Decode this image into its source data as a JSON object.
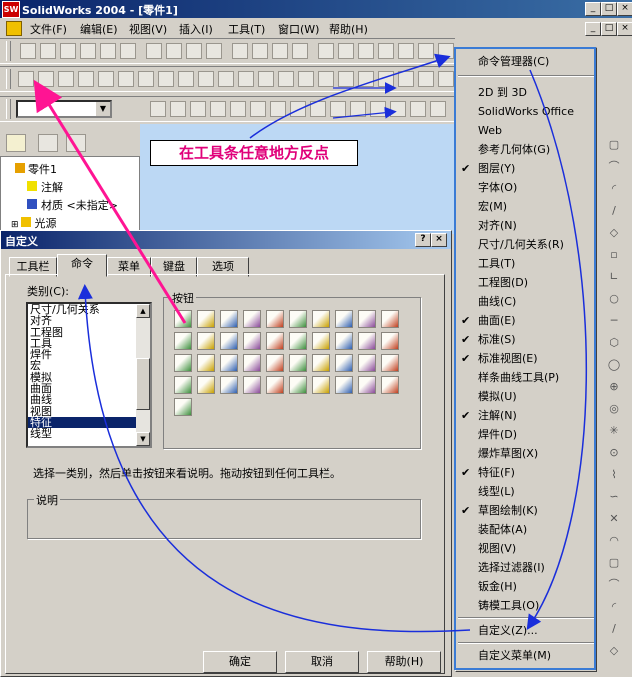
{
  "app": {
    "title": "SolidWorks 2004 - [零件1]",
    "logo_text": "SW"
  },
  "window_buttons": {
    "minimize": "_",
    "maximize": "□",
    "close": "×"
  },
  "menubar": {
    "items": [
      "文件(F)",
      "编辑(E)",
      "视图(V)",
      "插入(I)",
      "工具(T)",
      "窗口(W)",
      "帮助(H)"
    ]
  },
  "tree": {
    "items": [
      "零件1",
      "注解",
      "材质 <未指定>",
      "光源"
    ]
  },
  "callout": {
    "text": "在工具条任意地方反点"
  },
  "dialog": {
    "title": "自定义",
    "tabs": [
      "工具栏",
      "命令",
      "菜单",
      "键盘",
      "选项"
    ],
    "category_label": "类别(C):",
    "categories": [
      "尺寸/几何关系",
      "对齐",
      "工程图",
      "工具",
      "焊件",
      "宏",
      "模拟",
      "曲面",
      "曲线",
      "视图",
      "特征",
      "线型"
    ],
    "selected_category": "特征",
    "buttons_label": "按钮",
    "hint": "选择一类别，然后单击按钮来看说明。拖动按钮到任何工具栏。",
    "description_label": "说明",
    "ok": "确定",
    "cancel": "取消",
    "help": "帮助(H)"
  },
  "context_menu": {
    "items": [
      {
        "label": "命令管理器(C)",
        "checked": false
      },
      {
        "label": "2D 到 3D",
        "checked": false
      },
      {
        "label": "SolidWorks Office",
        "checked": false
      },
      {
        "label": "Web",
        "checked": false
      },
      {
        "label": "参考几何体(G)",
        "checked": false
      },
      {
        "label": "图层(Y)",
        "checked": true
      },
      {
        "label": "字体(O)",
        "checked": false
      },
      {
        "label": "宏(M)",
        "checked": false
      },
      {
        "label": "对齐(N)",
        "checked": false
      },
      {
        "label": "尺寸/几何关系(R)",
        "checked": false
      },
      {
        "label": "工具(T)",
        "checked": false
      },
      {
        "label": "工程图(D)",
        "checked": false
      },
      {
        "label": "曲线(C)",
        "checked": false
      },
      {
        "label": "曲面(E)",
        "checked": true
      },
      {
        "label": "标准(S)",
        "checked": true
      },
      {
        "label": "标准视图(E)",
        "checked": true
      },
      {
        "label": "样条曲线工具(P)",
        "checked": false
      },
      {
        "label": "模拟(U)",
        "checked": false
      },
      {
        "label": "注解(N)",
        "checked": true
      },
      {
        "label": "焊件(D)",
        "checked": false
      },
      {
        "label": "爆炸草图(X)",
        "checked": false
      },
      {
        "label": "特征(F)",
        "checked": true
      },
      {
        "label": "线型(L)",
        "checked": false
      },
      {
        "label": "草图绘制(K)",
        "checked": true
      },
      {
        "label": "装配体(A)",
        "checked": false
      },
      {
        "label": "视图(V)",
        "checked": false
      },
      {
        "label": "选择过滤器(I)",
        "checked": false
      },
      {
        "label": "钣金(H)",
        "checked": false
      },
      {
        "label": "铸模工具(O)",
        "checked": false
      },
      {
        "label": "自定义(Z)...",
        "checked": false
      },
      {
        "label": "自定义菜单(M)",
        "checked": false
      }
    ],
    "check_mark": "✔"
  },
  "colors": {
    "title_blue": "#0a246a",
    "callout_text": "#e0007a",
    "arrow_pink": "#ff1493",
    "arrow_blue": "#1a2edb",
    "menu_highlight_border": "#3a7bd5"
  }
}
